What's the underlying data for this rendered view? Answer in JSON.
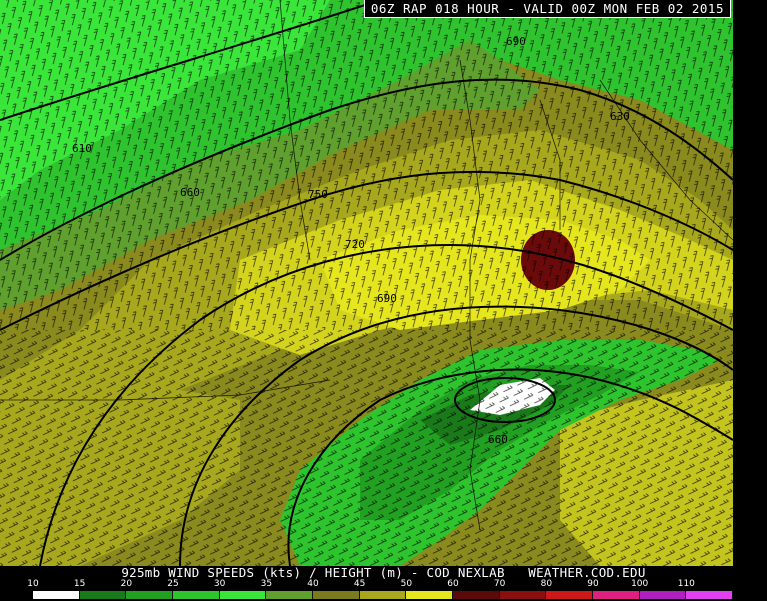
{
  "header": {
    "title": "06Z RAP 018 HOUR - VALID 00Z MON FEB 02 2015"
  },
  "footer": {
    "title": "925mb WIND SPEEDS (kts) / HEIGHT (m) - COD NEXLAB   WEATHER.COD.EDU"
  },
  "map": {
    "contour_labels": [
      "610",
      "660",
      "750",
      "720",
      "690",
      "690",
      "660",
      "630"
    ]
  },
  "colorbar": {
    "labels": [
      "10",
      "15",
      "20",
      "25",
      "30",
      "35",
      "40",
      "45",
      "50",
      "60",
      "70",
      "80",
      "90",
      "100",
      "110"
    ],
    "colors": [
      "#ffffff",
      "#1a7a1a",
      "#22a022",
      "#2ec42e",
      "#3ae63a",
      "#5fa02e",
      "#7a7a1e",
      "#a8a81e",
      "#e6e61e",
      "#5a0a0a",
      "#8a1010",
      "#cc1818",
      "#e02080",
      "#b020c0",
      "#e040f0"
    ]
  }
}
